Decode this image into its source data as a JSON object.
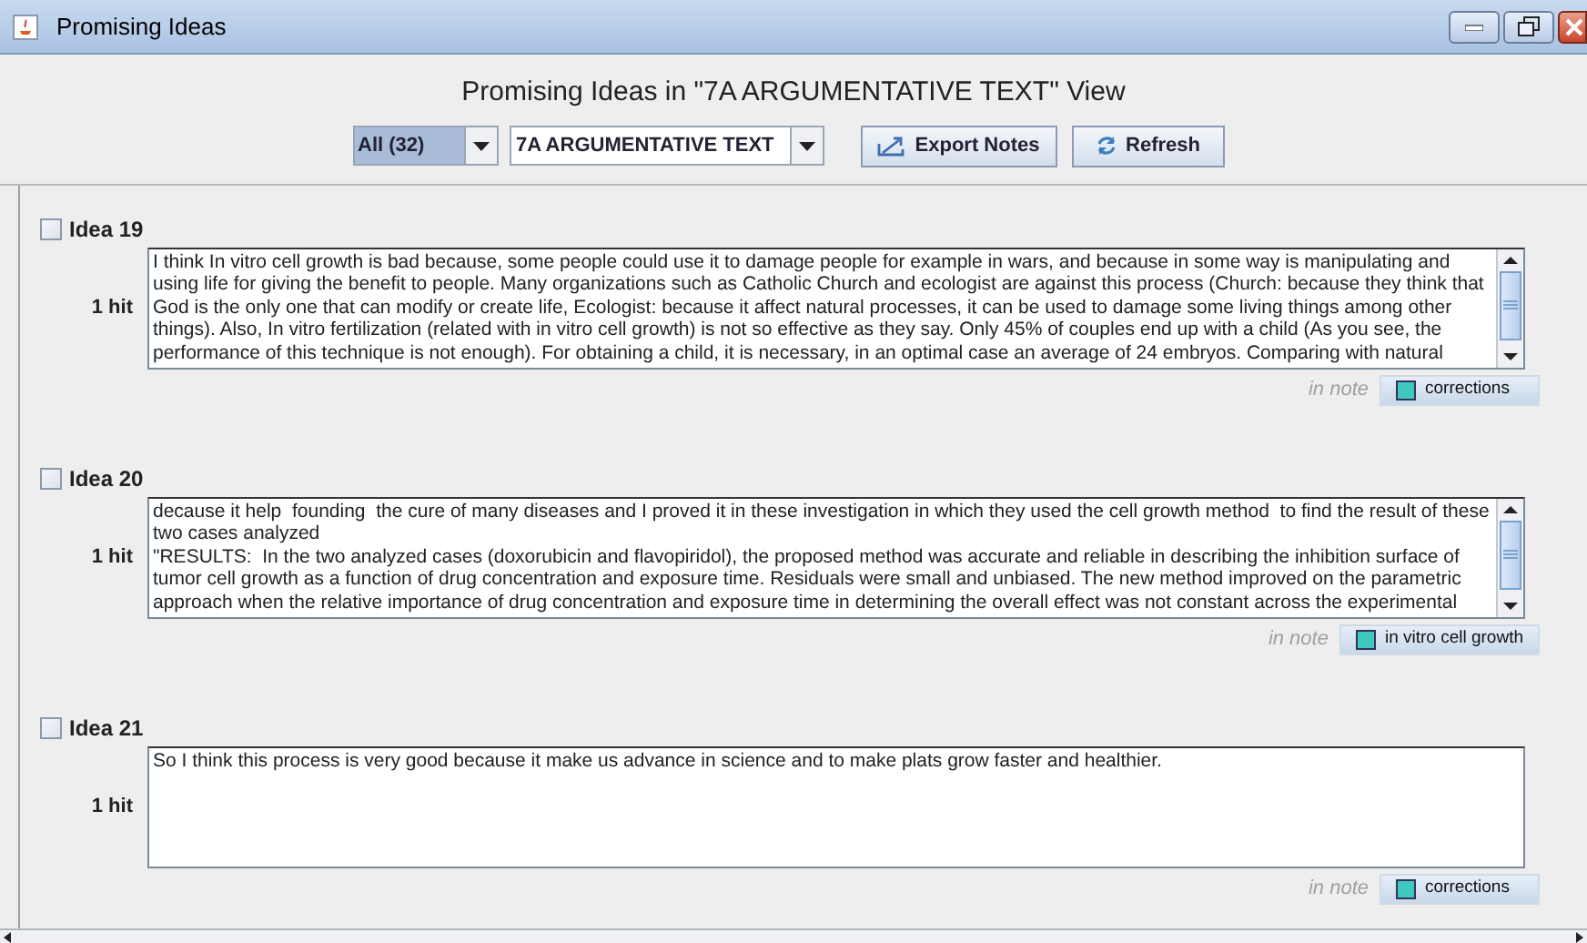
{
  "window": {
    "title": "Promising Ideas"
  },
  "heading": "Promising Ideas in \"7A ARGUMENTATIVE TEXT\" View",
  "toolbar": {
    "filter": "All (32)",
    "view": "7A ARGUMENTATIVE TEXT",
    "buttons": [
      {
        "label": "Export Notes",
        "kind": "export"
      },
      {
        "label": "Refresh",
        "kind": "refresh"
      }
    ]
  },
  "ideas": [
    {
      "title": "Idea 19",
      "checked": false,
      "hits": "1 hit",
      "scrollable": true,
      "lines": [
        "I think In vitro cell growth is bad because, some people could use it to damage people for example in wars, and because in some way is manipulating and",
        "using life for giving the benefit to people. Many organizations such as Catholic Church and ecologist are against this process (Church: because they think that",
        "God is the only one that can modify or create life, Ecologist: because it affect natural processes, it can be used to damage some living things among other",
        "things). Also, In vitro fertilization (related with in vitro cell growth) is not so effective as they say. Only 45% of couples end up with a child (As you see, the",
        "performance of this technique is not enough). For obtaining a child, it is necessary, in an optimal case an average of 24 embryos. Comparing with natural"
      ],
      "note_prefix": "in note",
      "note": {
        "label": "corrections",
        "color": "#3ec8c0"
      }
    },
    {
      "title": "Idea 20",
      "checked": false,
      "hits": "1 hit",
      "scrollable": true,
      "lines": [
        "decause it help  founding  the cure of many diseases and I proved it in these investigation in which they used the cell growth method  to find the result of these",
        "two cases analyzed",
        "\"RESULTS:  In the two analyzed cases (doxorubicin and flavopiridol), the proposed method was accurate and reliable in describing the inhibition surface of",
        "tumor cell growth as a function of drug concentration and exposure time. Residuals were small and unbiased. The new method improved on the parametric",
        "approach when the relative importance of drug concentration and exposure time in determining the overall effect was not constant across the experimental"
      ],
      "note_prefix": "in note",
      "note": {
        "label": "in vitro cell growth",
        "color": "#3ec8c0"
      }
    },
    {
      "title": "Idea 21",
      "checked": false,
      "hits": "1 hit",
      "scrollable": false,
      "lines": [
        "So I think this process is very good because it make us advance in science and to make plats grow faster and healthier."
      ],
      "note_prefix": "in note",
      "note": {
        "label": "corrections",
        "color": "#3ec8c0"
      }
    }
  ]
}
